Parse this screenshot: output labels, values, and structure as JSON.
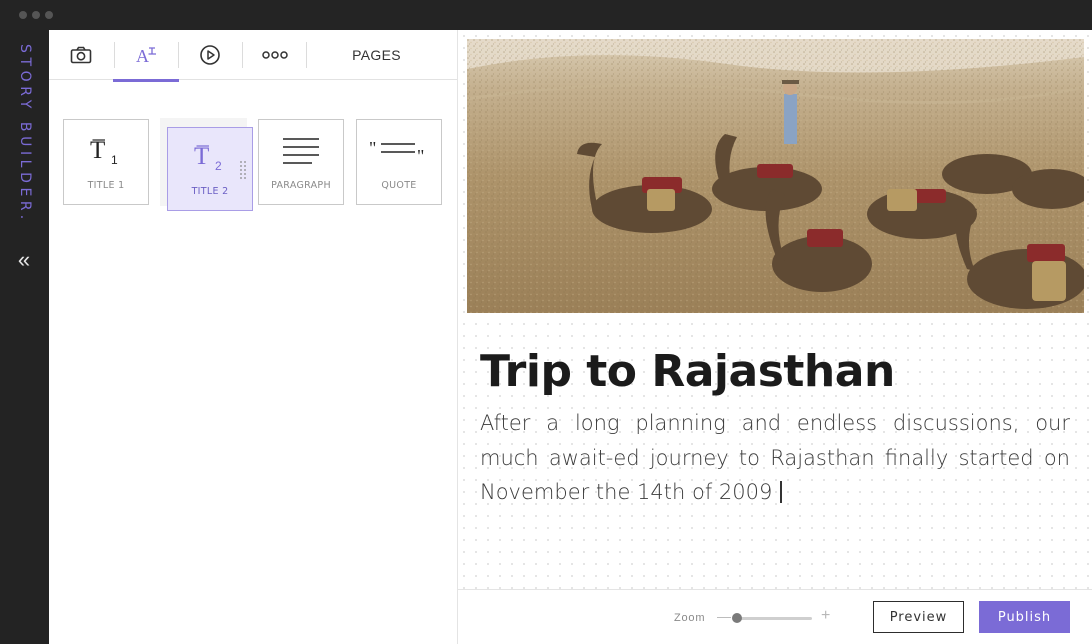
{
  "app": {
    "brand": "STORY BUILDER.",
    "accent_color": "#7b6bd6"
  },
  "tabs": [
    {
      "icon": "camera-icon"
    },
    {
      "icon": "text-style-icon",
      "active": true
    },
    {
      "icon": "play-icon"
    },
    {
      "icon": "more-dots-icon"
    },
    {
      "label": "PAGES"
    }
  ],
  "blocks": [
    {
      "label": "TITLE 1",
      "icon": "title1-icon"
    },
    {
      "label": "TITLE 2",
      "icon": "title2-icon",
      "selected": true
    },
    {
      "label": "PARAGRAPH",
      "icon": "paragraph-icon"
    },
    {
      "label": "QUOTE",
      "icon": "quote-icon"
    }
  ],
  "story": {
    "image": "camels-desert-photo",
    "title": "Trip to Rajasthan",
    "body": "After a long planning and endless discussions, our much await-ed journey to Rajasthan finally started on November the 14th of 2009"
  },
  "footer": {
    "zoom_label": "Zoom",
    "zoom_minus": "—",
    "zoom_plus": "+",
    "preview_label": "Preview",
    "publish_label": "Publish"
  }
}
